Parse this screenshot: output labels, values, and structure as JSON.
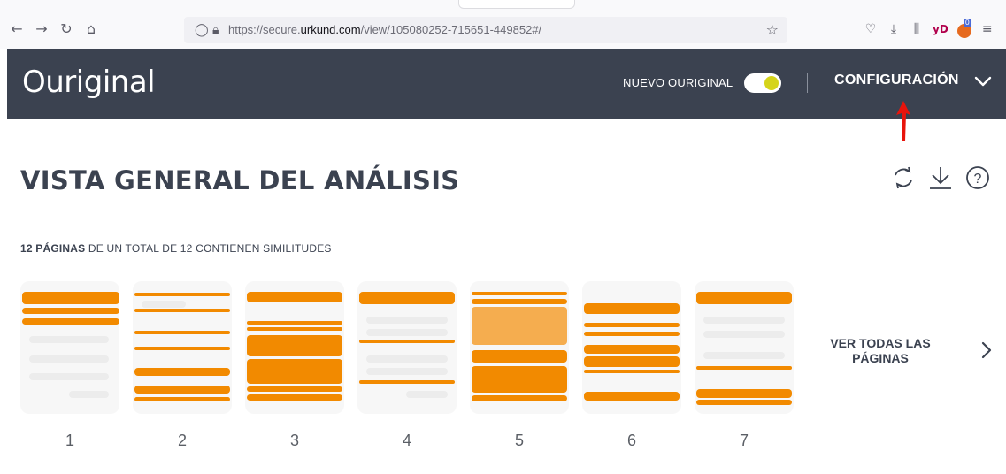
{
  "browser": {
    "url_prefix": "https://secure.",
    "url_domain": "urkund.com",
    "url_path": "/view/105080252-715651-449852#/",
    "extension_label": "yD",
    "extension_badge": "0"
  },
  "header": {
    "logo": "Ouriginal",
    "toggle_label": "NUEVO OURIGINAL",
    "toggle_on": true,
    "config_label": "CONFIGURACIÓN"
  },
  "main": {
    "title": "VISTA GENERAL DEL ANÁLISIS",
    "summary_bold": "12 PÁGINAS",
    "summary_rest": " DE UN TOTAL DE 12 CONTIENEN SIMILITUDES",
    "pages": [
      "1",
      "2",
      "3",
      "4",
      "5",
      "6",
      "7"
    ],
    "see_all": "VER TODAS LAS PÁGINAS"
  },
  "colors": {
    "header_bg": "#3b4250",
    "highlight": "#f28a00",
    "toggle_knob": "#d5d41a",
    "annotation": "#e8140c"
  },
  "icons": [
    "back-icon",
    "forward-icon",
    "reload-icon",
    "home-icon",
    "shield-icon",
    "lock-icon",
    "star-icon",
    "pocket-icon",
    "download-icon",
    "library-icon",
    "refresh-icon",
    "help-icon",
    "chevron-right-icon"
  ]
}
